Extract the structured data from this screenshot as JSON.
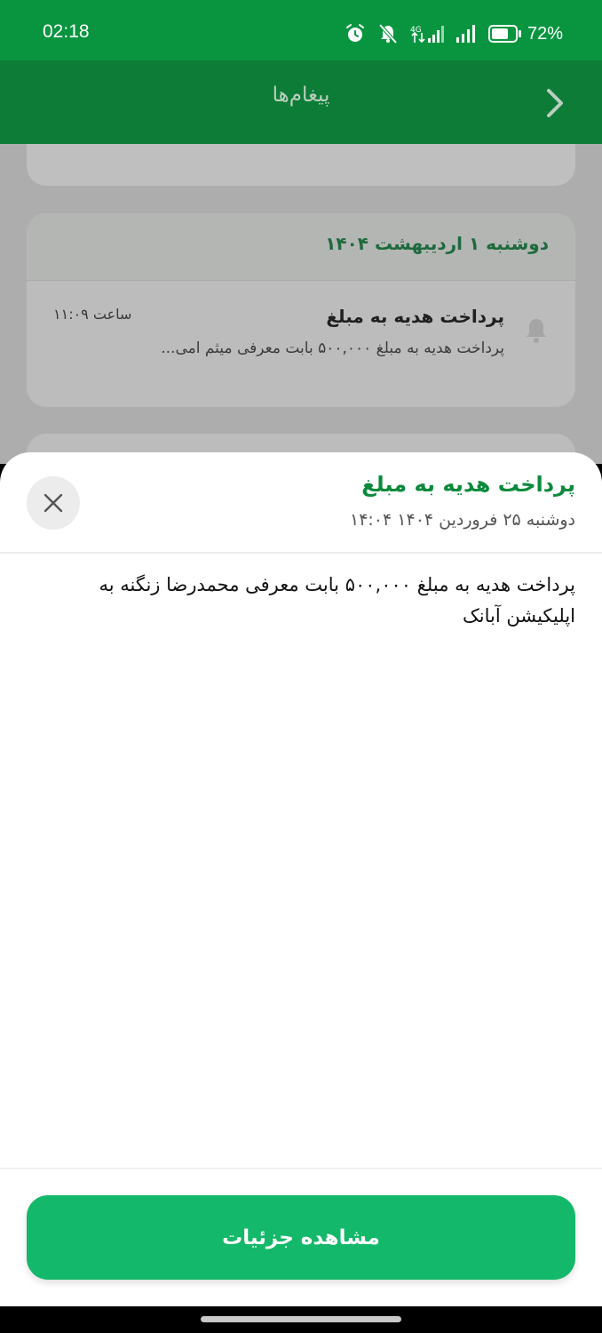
{
  "status_bar": {
    "time": "02:18",
    "network_label": "4G",
    "battery_percent": "72%",
    "battery_level": 0.72,
    "icons": [
      "alarm-icon",
      "bell-off-icon",
      "mobile-data-icon",
      "signal-icon",
      "battery-icon"
    ]
  },
  "app_bar": {
    "title": "پیغام‌ها",
    "back_icon": "chevron-right-icon"
  },
  "message_list": {
    "group_date": "دوشنبه ۱ اردیبهشت ۱۴۰۴",
    "item": {
      "icon": "bell-icon",
      "title": "پرداخت هدیه به مبلغ",
      "time": "ساعت ۱۱:۰۹",
      "snippet": "پرداخت هدیه به مبلغ ۵۰۰,۰۰۰ بابت معرفی میثم امی..."
    }
  },
  "sheet": {
    "title": "پرداخت هدیه به مبلغ",
    "date": "دوشنبه ۲۵ فروردین ۱۴۰۴ ۱۴:۰۴",
    "message": "پرداخت هدیه به مبلغ ۵۰۰,۰۰۰ بابت معرفی محمدرضا زنگنه به اپلیکیشن آبانک",
    "close_icon": "close-icon",
    "details_button": "مشاهده جزئیات"
  },
  "colors": {
    "status_bar": "#099540",
    "app_bar": "#0c7c36",
    "accent_text": "#0c8a3c",
    "primary_button": "#14b86a"
  }
}
